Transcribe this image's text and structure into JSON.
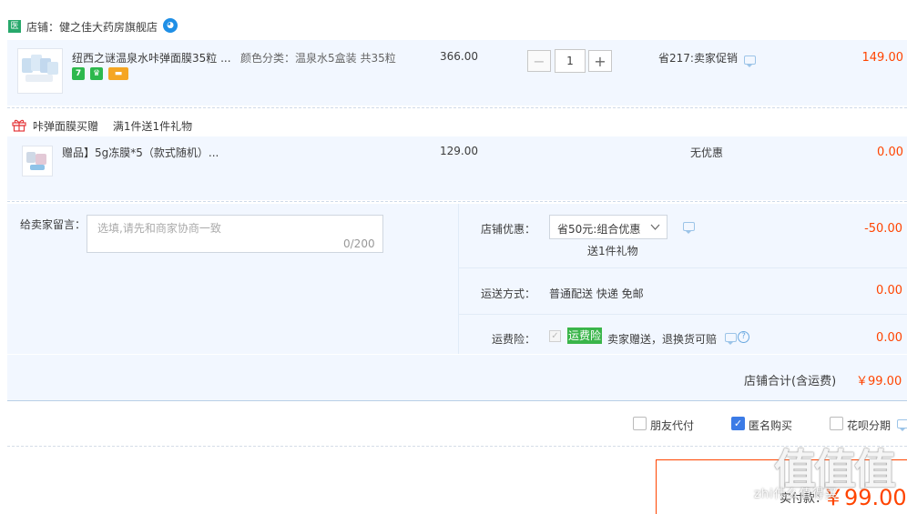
{
  "shop": {
    "badge": "医",
    "name": "店铺：健之佳大药房旗舰店",
    "wang_icon": "wangwang-chat-icon"
  },
  "item1": {
    "title": "纽西之谜温泉水咔弹面膜35粒 ...",
    "sku": "颜色分类：温泉水5盒装 共35粒",
    "price": "366.00",
    "quantity": "1",
    "minus": "−",
    "plus": "+",
    "promo": "省217:卖家促销",
    "subtotal": "149.00",
    "tag_seven": "7"
  },
  "gift_group": {
    "title": "咔弹面膜买赠",
    "rule": "满1件送1件礼物"
  },
  "item2": {
    "title": "赠品】5g冻膜*5（款式随机）...",
    "price": "129.00",
    "promo": "无优惠",
    "subtotal": "0.00"
  },
  "message": {
    "label": "给卖家留言：",
    "placeholder": "选填,请先和商家协商一致",
    "counter": "0/200"
  },
  "shop_discount": {
    "label": "店铺优惠：",
    "selected": "省50元:组合优惠",
    "note": "送1件礼物",
    "amount": "-50.00"
  },
  "shipping": {
    "label": "运送方式：",
    "value": "普通配送 快递 免邮",
    "amount": "0.00"
  },
  "insurance": {
    "label": "运费险：",
    "tag": "运费险",
    "desc": "卖家赠送，退换货可赔",
    "amount": "0.00",
    "help": "?"
  },
  "shop_total": {
    "label": "店铺合计(含运费)",
    "value": "￥99.00"
  },
  "options": {
    "friend_pay": "朋友代付",
    "anonymous": "匿名购买",
    "huabei": "花呗分期"
  },
  "payment": {
    "label": "实付款：",
    "value": "￥99.00"
  },
  "watermark": {
    "logo": "值值值",
    "site": "zhi什么值得买"
  },
  "colors": {
    "accent_red": "#ff4400",
    "row_bg": "#f2f7ff",
    "check_blue": "#3b7be6",
    "insurance_green": "#3ab54a"
  }
}
